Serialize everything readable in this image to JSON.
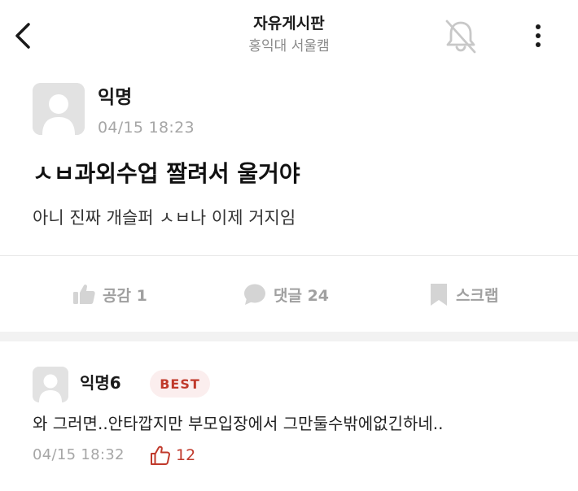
{
  "header": {
    "title": "자유게시판",
    "subtitle": "홍익대 서울캠",
    "icons": {
      "back": "chevron-left-icon",
      "notification": "bell-off-icon",
      "more": "more-vertical-icon"
    }
  },
  "post": {
    "author": "익명",
    "time": "04/15 18:23",
    "title": "ㅅㅂ과외수업 짤려서 울거야",
    "body": "아니 진짜 개슬퍼 ㅅㅂ나 이제 거지임",
    "actions": {
      "like_label": "공감 1",
      "comment_label": "댓글 24",
      "scrap_label": "스크랩"
    }
  },
  "comments": [
    {
      "author": "익명6",
      "badge": "BEST",
      "body": "와 그러면..안타깝지만 부모입장에서 그만둘수밖에없긴하네..",
      "time": "04/15 18:32",
      "likes": "12"
    }
  ],
  "colors": {
    "accent": "#c0392b",
    "muted": "#a0a0a0",
    "badge_bg": "#fbeeee",
    "divider": "#f2f2f2"
  }
}
